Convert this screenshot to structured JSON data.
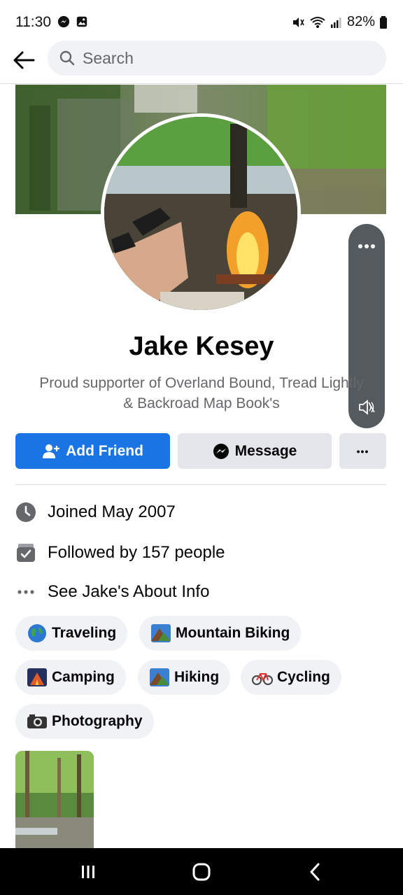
{
  "status_bar": {
    "time": "11:30",
    "battery": "82%"
  },
  "header": {
    "search_placeholder": "Search"
  },
  "profile": {
    "name": "Jake Kesey",
    "bio": "Proud supporter of Overland Bound, Tread Lightly & Backroad Map Book's"
  },
  "actions": {
    "add_friend": "Add Friend",
    "message": "Message",
    "more": "•••"
  },
  "details": {
    "joined": "Joined May 2007",
    "followed": "Followed by 157 people",
    "about": "See Jake's About Info"
  },
  "hobbies": [
    {
      "label": "Traveling",
      "icon": "globe-icon"
    },
    {
      "label": "Mountain Biking",
      "icon": "mountain-icon"
    },
    {
      "label": "Camping",
      "icon": "camping-icon"
    },
    {
      "label": "Hiking",
      "icon": "mountain-icon"
    },
    {
      "label": "Cycling",
      "icon": "bicycle-icon"
    },
    {
      "label": "Photography",
      "icon": "camera-icon"
    }
  ],
  "colors": {
    "primary": "#1b74e4",
    "secondary_button": "#e4e6eb",
    "muted_text": "#65676b"
  }
}
